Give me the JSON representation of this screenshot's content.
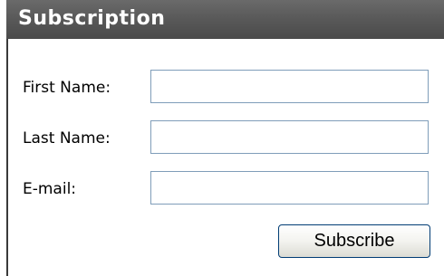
{
  "panel": {
    "title": "Subscription"
  },
  "form": {
    "first_name_label": "First Name:",
    "first_name_value": "",
    "last_name_label": "Last Name:",
    "last_name_value": "",
    "email_label": "E-mail:",
    "email_value": "",
    "submit_label": "Subscribe"
  },
  "colors": {
    "header_background": "#555555",
    "header_text": "#ffffff",
    "input_border": "#7f9db9",
    "button_border": "#003c74"
  }
}
